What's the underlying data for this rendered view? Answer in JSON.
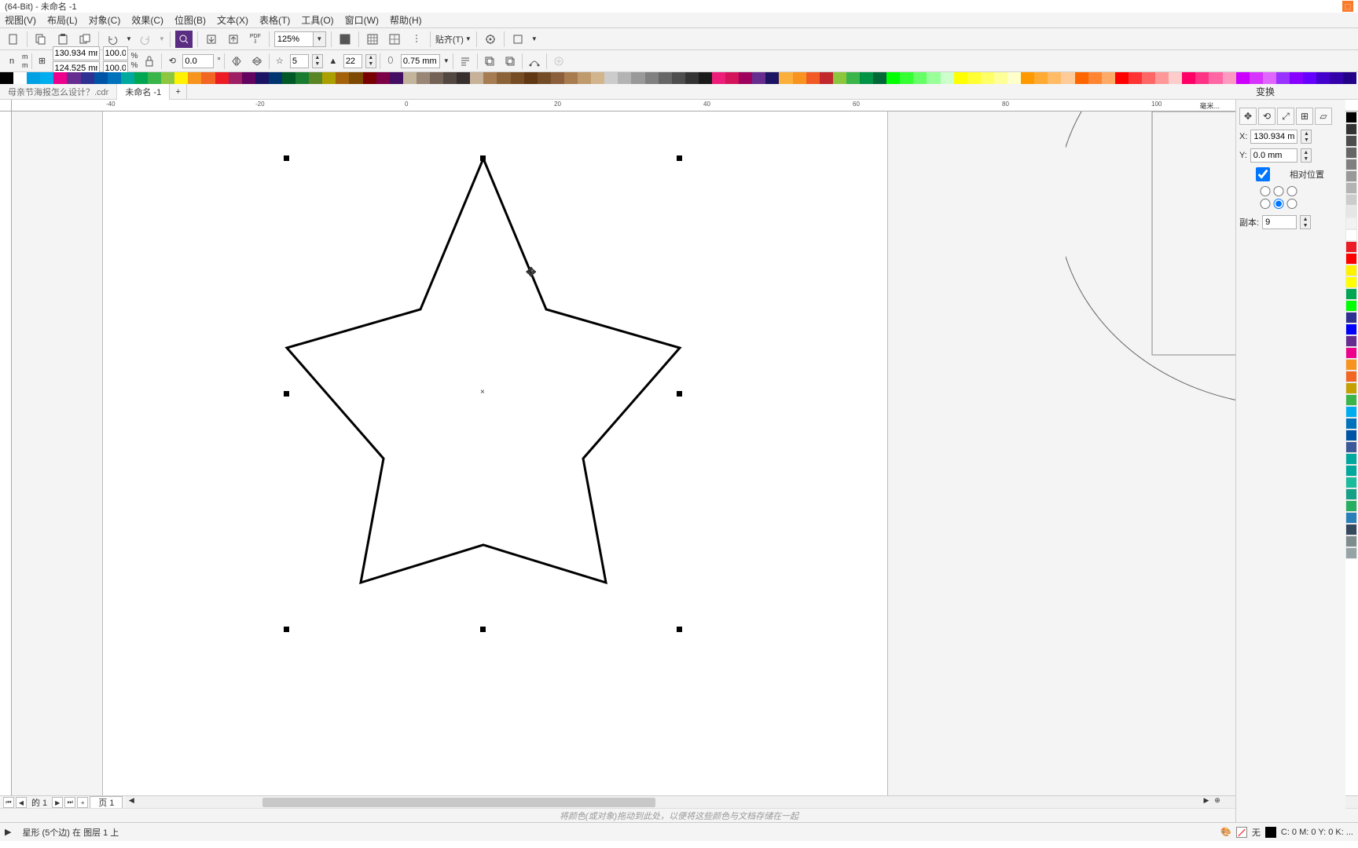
{
  "title": "(64-Bit) - 未命名 -1",
  "menu": [
    "视图(V)",
    "布局(L)",
    "对象(C)",
    "效果(C)",
    "位图(B)",
    "文本(X)",
    "表格(T)",
    "工具(O)",
    "窗口(W)",
    "帮助(H)"
  ],
  "zoom": "125%",
  "snap_label": "贴齐(T)",
  "props": {
    "width": "130.934 mm",
    "height": "124.525 mm",
    "sx": "100.0",
    "sy": "100.0",
    "rot": "0.0",
    "points": "5",
    "sharp": "22",
    "outline": "0.75 mm"
  },
  "tabs": [
    "母亲节海报怎么设计？.cdr",
    "未命名 -1"
  ],
  "ruler_unit": "毫米...",
  "right": {
    "title": "变换",
    "x": "130.934 mm",
    "y": "0.0 mm",
    "relative": "相对位置",
    "copies_label": "副本:",
    "copies": "9"
  },
  "page": {
    "nav": "的 1",
    "tab": "页 1"
  },
  "hint": "将颜色(或对象)拖动到此处，以便将这些颜色与文档存储在一起",
  "status": {
    "obj": "星形 (5个边) 在 图层 1 上",
    "none": "无",
    "fill": "C: 0 M: 0 Y: 0 K: ..."
  },
  "colors_top": [
    "#000000",
    "#ffffff",
    "#00a1e4",
    "#00aeef",
    "#ec008c",
    "#662d91",
    "#2e3192",
    "#0054a6",
    "#0072bc",
    "#00a99d",
    "#00a651",
    "#39b54a",
    "#8dc63f",
    "#fff200",
    "#f7941d",
    "#f26522",
    "#ed1c24",
    "#9e1f63",
    "#630460",
    "#1b1464",
    "#003471",
    "#005826",
    "#197b30",
    "#598527",
    "#aba000",
    "#a3620a",
    "#7d4900",
    "#790000",
    "#7b0046",
    "#440e62",
    "#c2b59b",
    "#998675",
    "#736357",
    "#534741",
    "#362f2e",
    "#c7b299",
    "#a67c52",
    "#8c6239",
    "#754c24",
    "#603813",
    "#754c28",
    "#8b5e3c",
    "#a97c50",
    "#bf9a6c",
    "#d3b58d",
    "#cccccc",
    "#b3b3b3",
    "#999999",
    "#808080",
    "#666666",
    "#4d4d4d",
    "#333333",
    "#1a1a1a",
    "#ed1e79",
    "#d4145a",
    "#9e005d",
    "#662d8f",
    "#1b1463",
    "#fbb03b",
    "#f7931e",
    "#f15a24",
    "#c1272d",
    "#8cc63f",
    "#39b54a",
    "#009245",
    "#006837",
    "#00ff00",
    "#33ff33",
    "#66ff66",
    "#99ff99",
    "#ccffcc",
    "#ffff00",
    "#ffff33",
    "#ffff66",
    "#ffff99",
    "#ffffcc",
    "#ff9900",
    "#ffaa33",
    "#ffbb66",
    "#ffcc99",
    "#ff6600",
    "#ff8533",
    "#ffaa66",
    "#ff0000",
    "#ff3333",
    "#ff6666",
    "#ff9999",
    "#ffcccc",
    "#ff0066",
    "#ff3385",
    "#ff66a3",
    "#ff99c2",
    "#cc00ff",
    "#d633ff",
    "#e066ff",
    "#9933ff",
    "#8800ff",
    "#6600ff",
    "#4400cc",
    "#3300aa",
    "#220088"
  ],
  "colors_side": [
    "#000000",
    "#333333",
    "#4d4d4d",
    "#666666",
    "#808080",
    "#999999",
    "#b3b3b3",
    "#cccccc",
    "#e6e6e6",
    "#f2f2f2",
    "#ffffff",
    "#ed1c24",
    "#ff0000",
    "#fff200",
    "#ffff00",
    "#00a651",
    "#00ff00",
    "#2e3192",
    "#0000ff",
    "#662d91",
    "#ec008c",
    "#f7941d",
    "#f26522",
    "#c4a000",
    "#39b54a",
    "#00aeef",
    "#0072bc",
    "#0054a6",
    "#3b5998",
    "#00a99d",
    "#00a89d",
    "#1abc9c",
    "#16a085",
    "#27ae60",
    "#2980b9",
    "#34495e",
    "#7f8c8d",
    "#95a5a6"
  ]
}
